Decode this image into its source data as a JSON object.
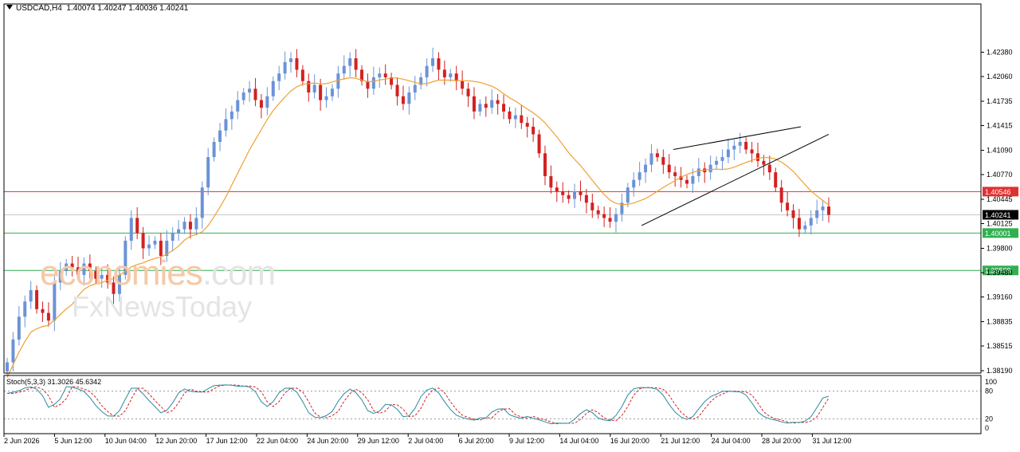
{
  "header": {
    "symbol": "USDCAD,H4",
    "open": "1.40074",
    "high": "1.40247",
    "low": "1.40036",
    "close": "1.40241"
  },
  "stoch": {
    "label": "Stoch(5,3,3)",
    "main": "31.3026",
    "signal": "45.6342",
    "levels": [
      "100",
      "80",
      "20",
      "0"
    ]
  },
  "watermark": {
    "line1a": "economies",
    "line1b": ".com",
    "line2": "FxNewsToday"
  },
  "colors": {
    "bull": "#6b93d6",
    "bear": "#d42020",
    "ma": "#f0a030",
    "resistance": "#e03030",
    "support": "#30b050",
    "current": "#000000",
    "stoch_main": "#2b8a9e",
    "stoch_signal": "#d42020"
  },
  "chart_data": {
    "type": "candlestick",
    "symbol": "USDCAD",
    "timeframe": "H4",
    "ylim": [
      1.3819,
      1.427
    ],
    "y_ticks": [
      "1.42380",
      "1.42060",
      "1.41735",
      "1.41415",
      "1.41090",
      "1.40770",
      "1.40445",
      "1.40125",
      "1.39800",
      "1.39480",
      "1.39160",
      "1.38835",
      "1.38515",
      "1.38190"
    ],
    "x_ticks": [
      "2 Jun 2026",
      "5 Jun 12:00",
      "10 Jun 04:00",
      "12 Jun 20:00",
      "17 Jun 12:00",
      "22 Jun 04:00",
      "24 Jun 20:00",
      "29 Jun 12:00",
      "2 Jul 04:00",
      "6 Jul 20:00",
      "9 Jul 12:00",
      "14 Jul 04:00",
      "16 Jul 20:00",
      "21 Jul 12:00",
      "24 Jul 04:00",
      "28 Jul 20:00",
      "31 Jul 12:00"
    ],
    "price_levels": [
      {
        "name": "resistance",
        "value": 1.40546,
        "label": "1.40546"
      },
      {
        "name": "current",
        "value": 1.40241,
        "label": "1.40241"
      },
      {
        "name": "support-1",
        "value": 1.40001,
        "label": "1.40001"
      },
      {
        "name": "support-2",
        "value": 1.39509,
        "label": "1.39509"
      }
    ],
    "closes": [
      1.383,
      1.386,
      1.389,
      1.391,
      1.3925,
      1.39,
      1.3895,
      1.3885,
      1.3935,
      1.395,
      1.396,
      1.3955,
      1.3945,
      1.396,
      1.395,
      1.394,
      1.3945,
      1.3935,
      1.392,
      1.3945,
      1.399,
      1.402,
      1.4,
      1.398,
      1.3985,
      1.399,
      1.397,
      1.399,
      1.4,
      1.4005,
      1.4015,
      1.4005,
      1.402,
      1.406,
      1.41,
      1.412,
      1.4135,
      1.415,
      1.416,
      1.4175,
      1.4185,
      1.419,
      1.4175,
      1.4165,
      1.418,
      1.42,
      1.421,
      1.4225,
      1.423,
      1.4215,
      1.42,
      1.4185,
      1.4195,
      1.4175,
      1.418,
      1.419,
      1.421,
      1.422,
      1.423,
      1.4215,
      1.42,
      1.419,
      1.4205,
      1.421,
      1.4205,
      1.4195,
      1.418,
      1.417,
      1.4185,
      1.4195,
      1.4205,
      1.422,
      1.423,
      1.4215,
      1.4205,
      1.421,
      1.42,
      1.419,
      1.418,
      1.416,
      1.417,
      1.4165,
      1.4175,
      1.417,
      1.416,
      1.415,
      1.4155,
      1.4145,
      1.414,
      1.413,
      1.4105,
      1.4075,
      1.406,
      1.4055,
      1.405,
      1.4045,
      1.4055,
      1.405,
      1.404,
      1.403,
      1.4025,
      1.402,
      1.4015,
      1.4025,
      1.404,
      1.406,
      1.407,
      1.408,
      1.409,
      1.4105,
      1.41,
      1.409,
      1.408,
      1.4075,
      1.407,
      1.4065,
      1.4075,
      1.4085,
      1.408,
      1.409,
      1.4095,
      1.41,
      1.411,
      1.4115,
      1.412,
      1.411,
      1.4105,
      1.4095,
      1.409,
      1.408,
      1.406,
      1.404,
      1.403,
      1.402,
      1.4005,
      1.401,
      1.402,
      1.403,
      1.4035,
      1.4024
    ],
    "ma_period": 50,
    "stochastic": {
      "k": 5,
      "d": 3,
      "slowing": 3,
      "main": 31.3026,
      "signal": 45.6342,
      "levels": [
        80,
        20
      ]
    },
    "trendlines": [
      {
        "name": "wedge-upper",
        "from": 1.411,
        "to": 1.414
      },
      {
        "name": "wedge-lower",
        "from": 1.401,
        "to": 1.413
      }
    ]
  }
}
